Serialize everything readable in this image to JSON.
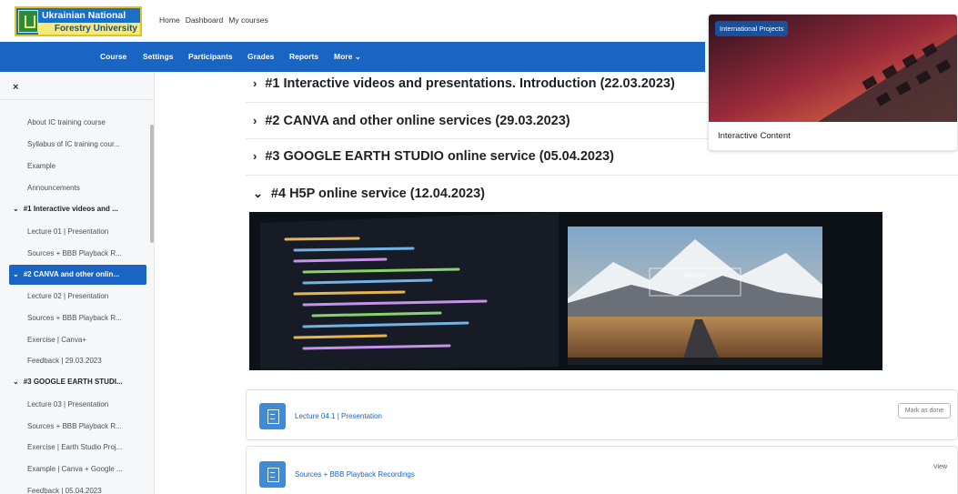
{
  "header": {
    "logo_line1": "Ukrainian National",
    "logo_line2": "Forestry University",
    "nav": [
      "Home",
      "Dashboard",
      "My courses"
    ]
  },
  "course_nav": {
    "items": [
      "Course",
      "Settings",
      "Participants",
      "Grades",
      "Reports",
      "More"
    ],
    "more_chevron": "⌄"
  },
  "drawer": {
    "close_label": "×",
    "items": [
      {
        "label": "About IC training course",
        "type": "item"
      },
      {
        "label": "Syllabus of IC training cour...",
        "type": "item"
      },
      {
        "label": "Example",
        "type": "item"
      },
      {
        "label": "Announcements",
        "type": "item"
      },
      {
        "label": "#1 Interactive videos and ...",
        "type": "section"
      },
      {
        "label": "Lecture 01 | Presentation",
        "type": "item"
      },
      {
        "label": "Sources + BBB Playback R...",
        "type": "item"
      },
      {
        "label": "#2 CANVA and other onlin...",
        "type": "section",
        "active": true
      },
      {
        "label": "Lecture 02 | Presentation",
        "type": "item"
      },
      {
        "label": "Sources + BBB Playback R...",
        "type": "item"
      },
      {
        "label": "Exercise | Canva+",
        "type": "item"
      },
      {
        "label": "Feedback | 29.03.2023",
        "type": "item"
      },
      {
        "label": "#3 GOOGLE EARTH STUDI...",
        "type": "section"
      },
      {
        "label": "Lecture 03 | Presentation",
        "type": "item"
      },
      {
        "label": "Sources + BBB Playback R...",
        "type": "item"
      },
      {
        "label": "Exercise | Earth Studio Proj...",
        "type": "item"
      },
      {
        "label": "Example | Canva + Google ...",
        "type": "item"
      },
      {
        "label": "Feedback | 05.04.2023",
        "type": "item"
      }
    ]
  },
  "sections": [
    {
      "title": "#1 Interactive videos and presentations. Introduction (22.03.2023)",
      "expanded": false
    },
    {
      "title": "#2 CANVA and other online services (29.03.2023)",
      "expanded": false
    },
    {
      "title": "#3 GOOGLE EARTH STUDIO online service (05.04.2023)",
      "expanded": false
    },
    {
      "title": "#4 H5P online service (12.04.2023)",
      "expanded": true
    }
  ],
  "chevrons": {
    "collapsed": "›",
    "expanded": "⌄"
  },
  "activities": [
    {
      "name": "Lecture 04.1 | Presentation",
      "action": "Mark as done"
    },
    {
      "name": "Sources + BBB Playback Recordings",
      "action": "View"
    }
  ],
  "side_card": {
    "badge": "International Projects",
    "title": "Interactive Content"
  },
  "banner": {
    "overlay_text": "PAPERIX"
  },
  "colors": {
    "primary": "#1a64c4",
    "logo_blue": "#1a6fc9",
    "logo_yellow": "#f4e97a"
  }
}
